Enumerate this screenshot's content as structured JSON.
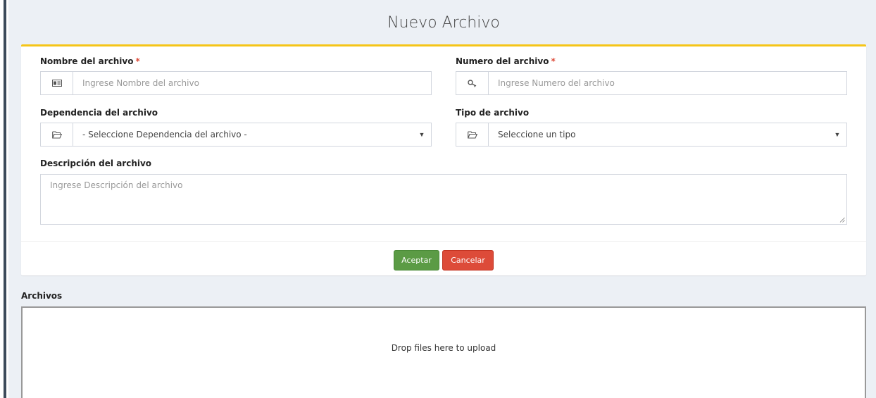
{
  "page": {
    "title": "Nuevo Archivo"
  },
  "form": {
    "nombre": {
      "label": "Nombre del archivo",
      "required_mark": "*",
      "icon": "id-card-icon",
      "placeholder": "Ingrese Nombre del archivo",
      "value": ""
    },
    "numero": {
      "label": "Numero del archivo",
      "required_mark": "*",
      "icon": "key-icon",
      "placeholder": "Ingrese Numero del archivo",
      "value": ""
    },
    "dependencia": {
      "label": "Dependencia del archivo",
      "icon": "folder-open-icon",
      "selected": "- Seleccione Dependencia del archivo -"
    },
    "tipo": {
      "label": "Tipo de archivo",
      "icon": "folder-open-icon",
      "selected": "Seleccione un tipo"
    },
    "descripcion": {
      "label": "Descripción del archivo",
      "placeholder": "Ingrese Descripción del archivo",
      "value": ""
    }
  },
  "actions": {
    "accept_label": "Aceptar",
    "cancel_label": "Cancelar"
  },
  "files": {
    "section_label": "Archivos",
    "dropzone_message": "Drop files here to upload"
  },
  "colors": {
    "accent_top_border": "#f5c518",
    "accept": "#5b9b45",
    "cancel": "#dd4b39",
    "required": "#dd4b39",
    "background": "#ecf0f5"
  }
}
